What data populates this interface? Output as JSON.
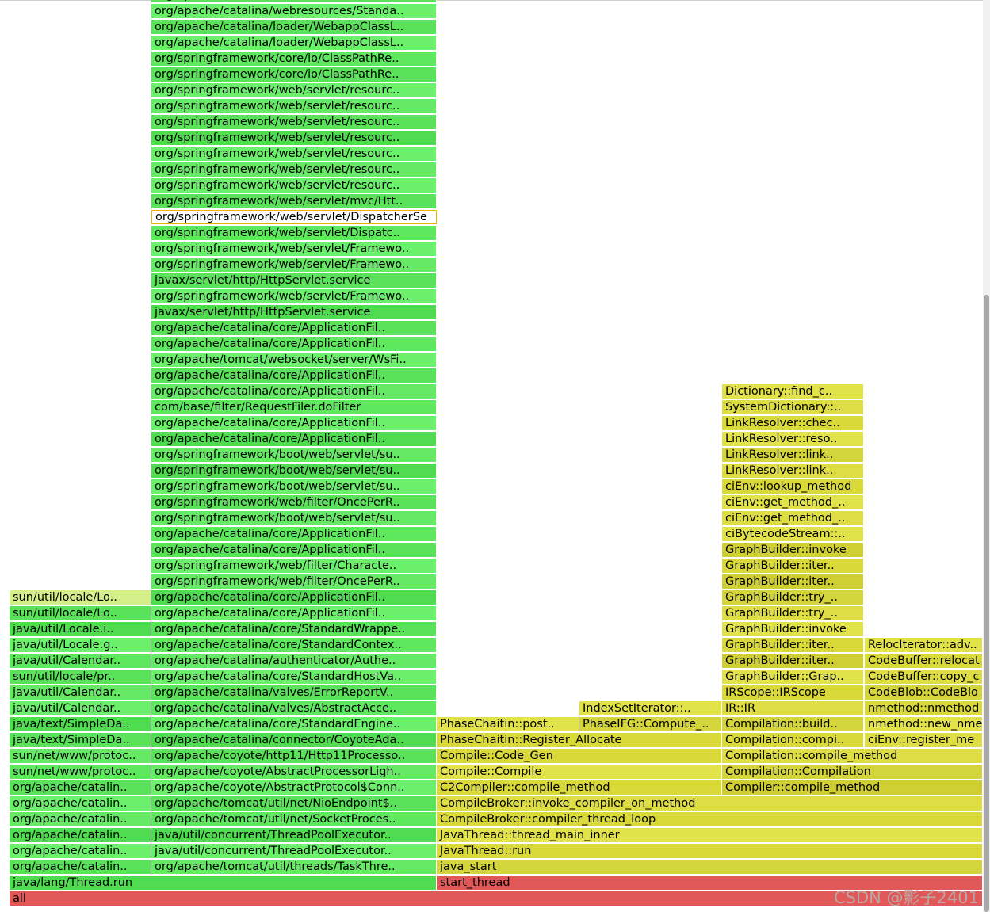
{
  "watermark": "CSDN @影子2401",
  "colors": {
    "java": [
      "#5ae35a",
      "#6af06a",
      "#50dc50",
      "#66ea66",
      "#5ee85e"
    ],
    "native": [
      "#d9d93a",
      "#e2e24a",
      "#cfcf34",
      "#dede44",
      "#d4d43c"
    ],
    "root": "#e05858",
    "light": "#d4ef8a"
  },
  "frames": {
    "col1": [
      {
        "label": "org/apache/catalina/webresources/Standa..",
        "c": 0
      },
      {
        "label": "org/apache/catalina/webresources/Standa..",
        "c": 1
      },
      {
        "label": "org/apache/catalina/loader/WebappClassL..",
        "c": 0
      },
      {
        "label": "org/apache/catalina/loader/WebappClassL..",
        "c": 1
      },
      {
        "label": "org/springframework/core/io/ClassPathRe..",
        "c": 4
      },
      {
        "label": "org/springframework/core/io/ClassPathRe..",
        "c": 0
      },
      {
        "label": "org/springframework/web/servlet/resourc..",
        "c": 1
      },
      {
        "label": "org/springframework/web/servlet/resourc..",
        "c": 3
      },
      {
        "label": "org/springframework/web/servlet/resourc..",
        "c": 0
      },
      {
        "label": "org/springframework/web/servlet/resourc..",
        "c": 2
      },
      {
        "label": "org/springframework/web/servlet/resourc..",
        "c": 1
      },
      {
        "label": "org/springframework/web/servlet/resourc..",
        "c": 3
      },
      {
        "label": "org/springframework/web/servlet/resourc..",
        "c": 1
      },
      {
        "label": "org/springframework/web/servlet/mvc/Htt..",
        "c": 0
      },
      {
        "label": "org/springframework/web/servlet/DispatcherSe",
        "c": 0,
        "hl": true
      },
      {
        "label": "org/springframework/web/servlet/Dispatc..",
        "c": 4
      },
      {
        "label": "org/springframework/web/servlet/Framewo..",
        "c": 1
      },
      {
        "label": "org/springframework/web/servlet/Framewo..",
        "c": 3
      },
      {
        "label": "javax/servlet/http/HttpServlet.service",
        "c": 0
      },
      {
        "label": "org/springframework/web/servlet/Framewo..",
        "c": 1
      },
      {
        "label": "javax/servlet/http/HttpServlet.service",
        "c": 2
      },
      {
        "label": "org/apache/catalina/core/ApplicationFil..",
        "c": 0
      },
      {
        "label": "org/apache/catalina/core/ApplicationFil..",
        "c": 4
      },
      {
        "label": "org/apache/tomcat/websocket/server/WsFi..",
        "c": 1
      },
      {
        "label": "org/apache/catalina/core/ApplicationFil..",
        "c": 0
      },
      {
        "label": "org/apache/catalina/core/ApplicationFil..",
        "c": 3
      },
      {
        "label": "com/base/filter/RequestFiler.doFilter",
        "c": 4
      },
      {
        "label": "org/apache/catalina/core/ApplicationFil..",
        "c": 1
      },
      {
        "label": "org/apache/catalina/core/ApplicationFil..",
        "c": 2
      },
      {
        "label": "org/springframework/boot/web/servlet/su..",
        "c": 3
      },
      {
        "label": "org/springframework/boot/web/servlet/su..",
        "c": 2
      },
      {
        "label": "org/springframework/boot/web/servlet/su..",
        "c": 1
      },
      {
        "label": "org/springframework/web/filter/OncePerR..",
        "c": 0
      },
      {
        "label": "org/springframework/boot/web/servlet/su..",
        "c": 3
      },
      {
        "label": "org/apache/catalina/core/ApplicationFil..",
        "c": 4
      },
      {
        "label": "org/apache/catalina/core/ApplicationFil..",
        "c": 0
      },
      {
        "label": "org/springframework/web/filter/Characte..",
        "c": 1
      },
      {
        "label": "org/springframework/web/filter/OncePerR..",
        "c": 3
      },
      {
        "label": "org/apache/catalina/core/ApplicationFil..",
        "c": 2
      },
      {
        "label": "org/apache/catalina/core/ApplicationFil..",
        "c": 1
      },
      {
        "label": "org/apache/catalina/core/StandardWrappe..",
        "c": 0
      },
      {
        "label": "org/apache/catalina/core/StandardContex..",
        "c": 4
      },
      {
        "label": "org/apache/catalina/authenticator/Authe..",
        "c": 3
      },
      {
        "label": "org/apache/catalina/core/StandardHostVa..",
        "c": 1
      },
      {
        "label": "org/apache/catalina/valves/ErrorReportV..",
        "c": 0
      },
      {
        "label": "org/apache/catalina/valves/AbstractAcce..",
        "c": 4
      },
      {
        "label": "org/apache/catalina/core/StandardEngine..",
        "c": 1
      },
      {
        "label": "org/apache/catalina/connector/CoyoteAda..",
        "c": 2
      },
      {
        "label": "org/apache/coyote/http11/Http11Processo..",
        "c": 0
      },
      {
        "label": "org/apache/coyote/AbstractProcessorLigh..",
        "c": 3
      },
      {
        "label": "org/apache/coyote/AbstractProtocol$Conn..",
        "c": 1
      },
      {
        "label": "org/apache/tomcat/util/net/NioEndpoint$..",
        "c": 0
      },
      {
        "label": "org/apache/tomcat/util/net/SocketProces..",
        "c": 4
      },
      {
        "label": "java/util/concurrent/ThreadPoolExecutor..",
        "c": 2
      },
      {
        "label": "java/util/concurrent/ThreadPoolExecutor..",
        "c": 1
      },
      {
        "label": "org/apache/tomcat/util/threads/TaskThre..",
        "c": 3
      }
    ],
    "col0": [
      {
        "label": "sun/util/locale/Lo..",
        "c": "light"
      },
      {
        "label": "sun/util/locale/Lo..",
        "c": 0
      },
      {
        "label": "java/util/Locale.i..",
        "c": 2
      },
      {
        "label": "java/util/Locale.g..",
        "c": 1
      },
      {
        "label": "java/util/Calendar..",
        "c": 4
      },
      {
        "label": "sun/util/locale/pr..",
        "c": 0
      },
      {
        "label": "java/util/Calendar..",
        "c": 3
      },
      {
        "label": "java/util/Calendar..",
        "c": 1
      },
      {
        "label": "java/text/SimpleDa..",
        "c": 2
      },
      {
        "label": "java/text/SimpleDa..",
        "c": 0
      },
      {
        "label": "sun/net/www/protoc..",
        "c": 3
      },
      {
        "label": "sun/net/www/protoc..",
        "c": 4
      },
      {
        "label": "org/apache/catalin..",
        "c": 0
      },
      {
        "label": "org/apache/catalin..",
        "c": 1
      },
      {
        "label": "org/apache/catalin..",
        "c": 3
      },
      {
        "label": "org/apache/catalin..",
        "c": 2
      },
      {
        "label": "org/apache/catalin..",
        "c": 1
      },
      {
        "label": "org/apache/catalin..",
        "c": 0
      }
    ],
    "threadRun": {
      "label": "java/lang/Thread.run",
      "c": 2
    },
    "colC": [
      {
        "label": "Dictionary::find_c..",
        "c": 1
      },
      {
        "label": "SystemDictionary::..",
        "c": 3
      },
      {
        "label": "LinkResolver::chec..",
        "c": 0
      },
      {
        "label": "LinkResolver::reso..",
        "c": 1
      },
      {
        "label": "LinkResolver::link..",
        "c": 4
      },
      {
        "label": "LinkResolver::link..",
        "c": 3
      },
      {
        "label": "ciEnv::lookup_method",
        "c": 0
      },
      {
        "label": "ciEnv::get_method_..",
        "c": 1
      },
      {
        "label": "ciEnv::get_method_..",
        "c": 3
      },
      {
        "label": "ciBytecodeStream::..",
        "c": 1
      },
      {
        "label": "GraphBuilder::invoke",
        "c": 2
      },
      {
        "label": "GraphBuilder::iter..",
        "c": 0
      },
      {
        "label": "GraphBuilder::iter..",
        "c": 2
      },
      {
        "label": "GraphBuilder::try_..",
        "c": 4
      },
      {
        "label": "GraphBuilder::try_..",
        "c": 3
      },
      {
        "label": "GraphBuilder::invoke",
        "c": 1
      },
      {
        "label": "GraphBuilder::iter..",
        "c": 0
      },
      {
        "label": "GraphBuilder::iter..",
        "c": 2
      },
      {
        "label": "GraphBuilder::Grap..",
        "c": 1
      },
      {
        "label": "IRScope::IRScope",
        "c": 0
      },
      {
        "label": "IR::IR",
        "c": 3
      },
      {
        "label": "Compilation::build..",
        "c": 4
      },
      {
        "label": "Compilation::compi..",
        "c": 0
      }
    ],
    "colD": [
      {
        "label": "RelocIterator::adv..",
        "c": 1
      },
      {
        "label": "CodeBuffer::relocat",
        "c": 0
      },
      {
        "label": "CodeBuffer::copy_c",
        "c": 3
      },
      {
        "label": "CodeBlob::CodeBlo",
        "c": 4
      },
      {
        "label": "nmethod::nmethod",
        "c": 0
      },
      {
        "label": "nmethod::new_nmet",
        "c": 1
      },
      {
        "label": "ciEnv::register_me",
        "c": 3
      }
    ],
    "rowIndexSet": {
      "label": "IndexSetIterator::..",
      "c": 1
    },
    "rowPhaseIFG": {
      "label": "PhaseIFG::Compute_..",
      "c": 4
    },
    "rowPhasePost": {
      "label": "PhaseChaitin::post..",
      "c": 1
    },
    "rowRegAlloc": {
      "label": "PhaseChaitin::Register_Allocate",
      "c": 0
    },
    "rowCompileMethod": {
      "label": "Compilation::compile_method",
      "c": 3
    },
    "rowCodeGen": {
      "label": "Compile::Code_Gen",
      "c": 0
    },
    "rowCompilation": {
      "label": "Compilation::Compilation",
      "c": 4
    },
    "rowCompile": {
      "label": "Compile::Compile",
      "c": 1
    },
    "rowCompilerCompile": {
      "label": "Compiler::compile_method",
      "c": 2
    },
    "rowC2": {
      "label": "C2Compiler::compile_method",
      "c": 0
    },
    "bottom": [
      {
        "label": "CompileBroker::invoke_compiler_on_method",
        "c": 3
      },
      {
        "label": "CompileBroker::compiler_thread_loop",
        "c": 0
      },
      {
        "label": "JavaThread::thread_main_inner",
        "c": 1
      },
      {
        "label": "JavaThread::run",
        "c": 0
      },
      {
        "label": "java_start",
        "c": 4
      }
    ],
    "startThread": {
      "label": "start_thread",
      "c": "root"
    },
    "all": {
      "label": "all",
      "c": "root"
    }
  }
}
